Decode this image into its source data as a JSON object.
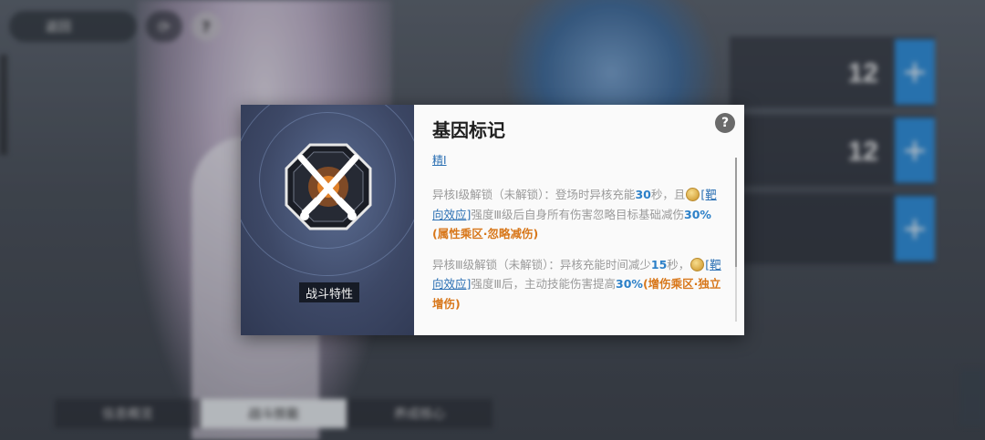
{
  "background": {
    "back_label": "返回",
    "counts": [
      "12",
      "12"
    ],
    "tabs": [
      "信息概览",
      "战斗技能",
      "养成核心"
    ]
  },
  "dialog": {
    "title": "基因标记",
    "help_symbol": "?",
    "trait_label": "战斗特性",
    "tier_tag": "精Ⅰ",
    "unlock1": {
      "prefix": "异核Ⅰ级解锁（未解锁）：登场时异核充能",
      "value": "30",
      "suffix_a": "秒，且",
      "link": "[靶向效应]",
      "body": "强度Ⅲ级后自身所有伤害忽略目标基础减伤",
      "value2": "30%",
      "zone": "(属性乘区·忽略减伤)"
    },
    "unlock2": {
      "prefix": "异核Ⅲ级解锁（未解锁）：异核充能时间减少",
      "value": "15",
      "suffix_a": "秒，",
      "link": "[靶向效应]",
      "body": "强度Ⅲ后，主动技能伤害提高",
      "value2": "30%",
      "zone": "(增伤乘区·独立增伤)"
    }
  },
  "colors": {
    "accent_blue": "#2c80c8",
    "zone_orange": "#d8771a",
    "plus_button": "#2e8fdc"
  }
}
